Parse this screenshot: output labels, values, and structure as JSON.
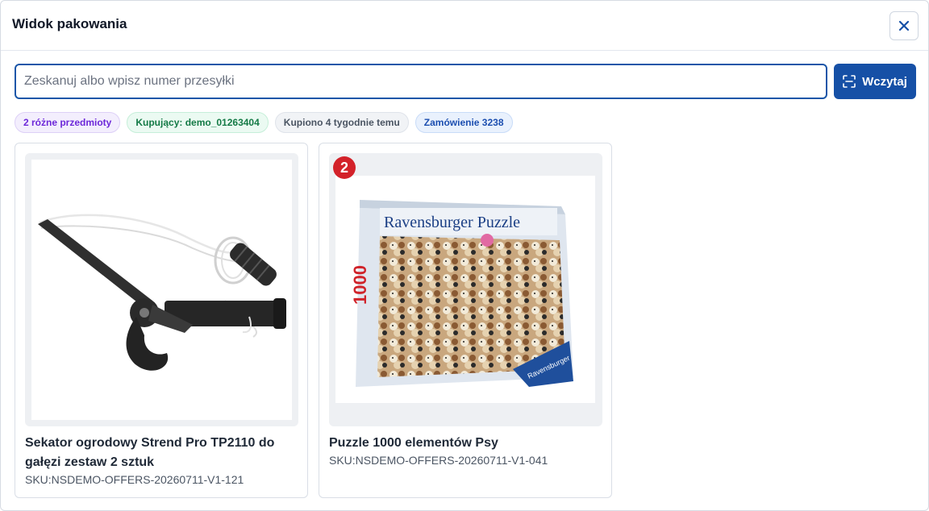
{
  "modal": {
    "title": "Widok pakowania"
  },
  "search": {
    "placeholder": "Zeskanuj albo wpisz numer przesyłki",
    "value": "",
    "load_label": "Wczytaj"
  },
  "badges": [
    {
      "label": "2 różne przedmioty"
    },
    {
      "label": "Kupujący: demo_01263404"
    },
    {
      "label": "Kupiono 4 tygodnie temu"
    },
    {
      "label": "Zamówienie 3238"
    }
  ],
  "items": [
    {
      "name": "Sekator ogrodowy Strend Pro TP2110 do gałęzi zestaw 2 sztuk",
      "sku": "SKU:NSDEMO-OFFERS-20260711-V1-121",
      "quantity": null
    },
    {
      "name": "Puzzle 1000 elementów Psy",
      "sku": "SKU:NSDEMO-OFFERS-20260711-V1-041",
      "quantity": "2",
      "image_text": {
        "brand": "Ravensburger Puzzle",
        "pieces": "1000",
        "corner_logo": "Ravensburger"
      }
    }
  ],
  "colors": {
    "primary": "#1650a6",
    "quantity_badge": "#d3222a"
  }
}
